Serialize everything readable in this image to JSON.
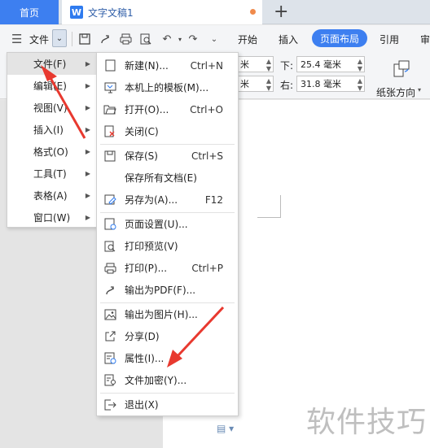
{
  "tabs": {
    "home": "首页",
    "document_title": "文字文稿1",
    "doc_badge": "W",
    "new_tab": "+"
  },
  "toolbar": {
    "file_label": "文件",
    "menu_dropdown_glyph": "⌄",
    "ribbon_tabs": [
      "开始",
      "插入",
      "页面布局",
      "引用",
      "审"
    ],
    "active_ribbon_tab": "页面布局"
  },
  "page_setup": {
    "bottom_label": "下:",
    "bottom_value": "25.4 毫米",
    "right_label": "右:",
    "right_value": "31.8 毫米",
    "left_top_value_suffix": "米",
    "left_bottom_value_suffix": "米",
    "orientation_label": "纸张方向"
  },
  "side_menu": {
    "items": [
      {
        "label": "文件(F)"
      },
      {
        "label": "编辑(E)"
      },
      {
        "label": "视图(V)"
      },
      {
        "label": "插入(I)"
      },
      {
        "label": "格式(O)"
      },
      {
        "label": "工具(T)"
      },
      {
        "label": "表格(A)"
      },
      {
        "label": "窗口(W)"
      }
    ]
  },
  "file_submenu": {
    "items": [
      {
        "label": "新建(N)...",
        "shortcut": "Ctrl+N",
        "icon": "new-doc-icon"
      },
      {
        "label": "本机上的模板(M)...",
        "shortcut": "",
        "icon": "template-icon"
      },
      {
        "label": "打开(O)...",
        "shortcut": "Ctrl+O",
        "icon": "folder-icon"
      },
      {
        "label": "关闭(C)",
        "shortcut": "",
        "icon": "close-doc-icon"
      },
      {
        "label": "保存(S)",
        "shortcut": "Ctrl+S",
        "icon": "save-icon"
      },
      {
        "label": "保存所有文档(E)",
        "shortcut": "",
        "icon": ""
      },
      {
        "label": "另存为(A)...",
        "shortcut": "F12",
        "icon": "save-as-icon"
      },
      {
        "label": "页面设置(U)...",
        "shortcut": "",
        "icon": "page-setup-icon"
      },
      {
        "label": "打印预览(V)",
        "shortcut": "",
        "icon": "print-preview-icon"
      },
      {
        "label": "打印(P)...",
        "shortcut": "Ctrl+P",
        "icon": "printer-icon"
      },
      {
        "label": "输出为PDF(F)...",
        "shortcut": "",
        "icon": "pdf-icon"
      },
      {
        "label": "输出为图片(H)...",
        "shortcut": "",
        "icon": "image-icon"
      },
      {
        "label": "分享(D)",
        "shortcut": "",
        "icon": "share-icon"
      },
      {
        "label": "属性(I)...",
        "shortcut": "",
        "icon": "properties-icon"
      },
      {
        "label": "文件加密(Y)...",
        "shortcut": "",
        "icon": "encrypt-icon"
      },
      {
        "label": "退出(X)",
        "shortcut": "",
        "icon": "exit-icon"
      }
    ]
  },
  "watermark": "软件技巧",
  "colors": {
    "accent": "#3d7ff0",
    "annotation_red": "#e8392f"
  }
}
